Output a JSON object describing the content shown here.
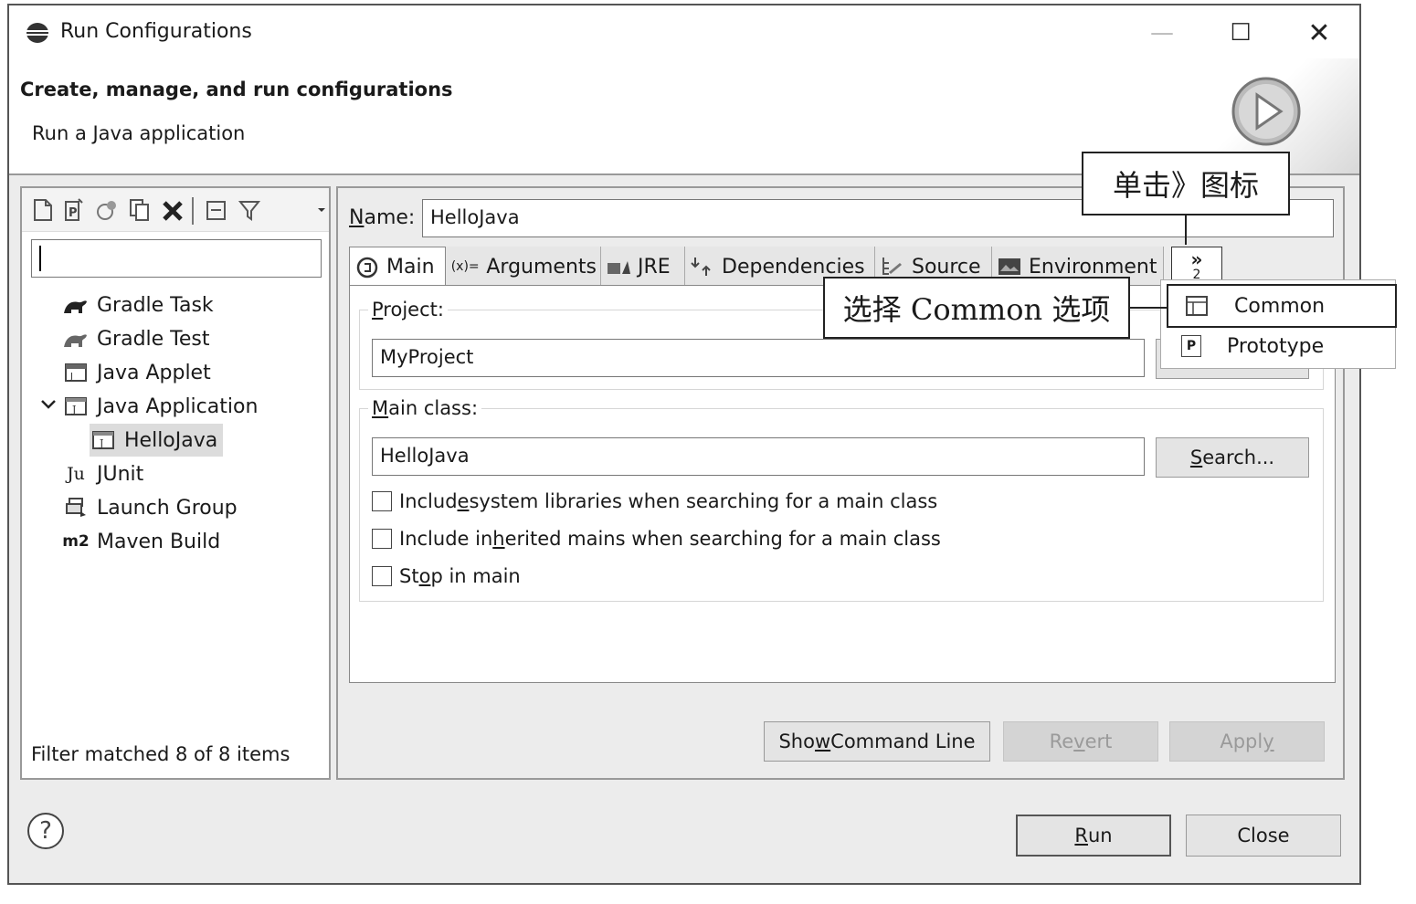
{
  "window": {
    "title": "Run Configurations",
    "minimize": "—",
    "maximize": "☐",
    "close": "✕"
  },
  "header": {
    "title": "Create, manage, and run configurations",
    "subtitle": "Run a Java application"
  },
  "left": {
    "filter_value": "",
    "items": [
      {
        "label": "Gradle Task",
        "icon": "gradle-elephant-icon"
      },
      {
        "label": "Gradle Test",
        "icon": "gradle-elephant-icon"
      },
      {
        "label": "Java Applet",
        "icon": "java-applet-icon"
      },
      {
        "label": "Java Application",
        "icon": "java-application-icon",
        "expanded": true
      },
      {
        "label": "HelloJava",
        "icon": "java-application-icon",
        "selected": true
      },
      {
        "label": "JUnit",
        "icon": "junit-icon",
        "icon_text": "Ju"
      },
      {
        "label": "Launch Group",
        "icon": "launch-group-icon"
      },
      {
        "label": "Maven Build",
        "icon": "maven-icon",
        "icon_text": "m2"
      }
    ],
    "status": "Filter matched 8 of 8 items"
  },
  "right": {
    "name_label_u": "N",
    "name_label_rest": "ame:",
    "name_value": "HelloJava",
    "tabs": [
      {
        "label": "Main",
        "icon": "main-icon"
      },
      {
        "label": "Arguments",
        "icon": "arguments-icon",
        "icon_text": "(x)="
      },
      {
        "label": "JRE",
        "icon": "jre-icon"
      },
      {
        "label": "Dependencies",
        "icon": "dependencies-icon"
      },
      {
        "label": "Source",
        "icon": "source-icon"
      },
      {
        "label": "Environment",
        "icon": "environment-icon"
      }
    ],
    "overflow_label": "»",
    "overflow_count": "2",
    "project_label_u": "P",
    "project_label_rest": "roject:",
    "project_value": "MyProject",
    "main_class_label_u": "M",
    "main_class_label_rest": "ain class:",
    "main_class_value": "HelloJava",
    "search_u": "S",
    "search_rest": "earch...",
    "checkboxes": [
      {
        "pre": "Includ",
        "u": "e",
        "post": " system libraries when searching for a main class",
        "checked": false
      },
      {
        "pre": "Include in",
        "u": "h",
        "post": "erited mains when searching for a main class",
        "checked": false
      },
      {
        "pre": "St",
        "u": "o",
        "post": "p in main",
        "checked": false
      }
    ],
    "show_cmd_pre": "Sho",
    "show_cmd_u": "w",
    "show_cmd_post": " Command Line",
    "revert_pre": "Re",
    "revert_u": "v",
    "revert_post": "ert",
    "apply_pre": "Appl",
    "apply_u": "y"
  },
  "dropdown": {
    "items": [
      {
        "label": "Common",
        "icon": "common-tab-icon",
        "highlighted": true
      },
      {
        "label": "Prototype",
        "icon": "prototype-icon",
        "icon_text": "P"
      }
    ]
  },
  "footer": {
    "help": "?",
    "run_u": "R",
    "run_rest": "un",
    "close": "Close"
  },
  "callouts": {
    "click_overflow": "单击》图标",
    "select_common": "选择 Common 选项"
  }
}
